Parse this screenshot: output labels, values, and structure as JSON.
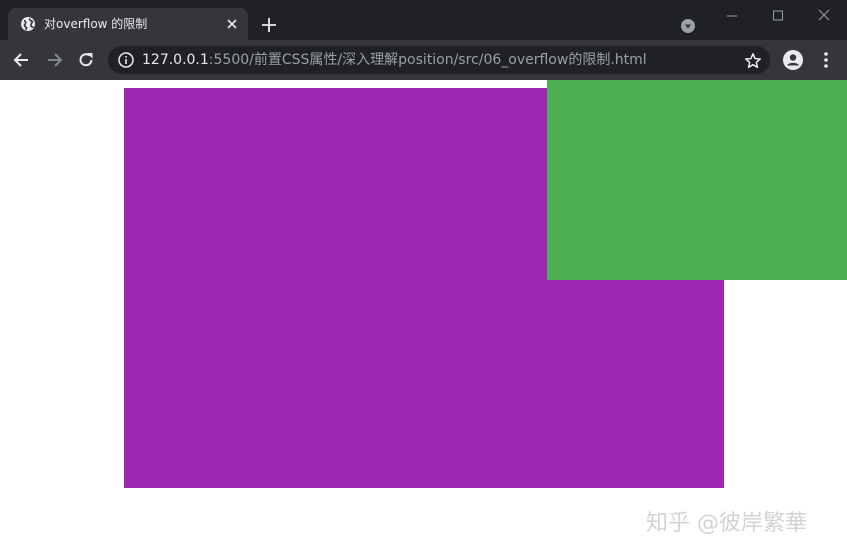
{
  "tab": {
    "title": "对overflow 的限制",
    "favicon": "globe-icon"
  },
  "window_controls": [
    "minimize-icon",
    "maximize-icon",
    "close-icon"
  ],
  "address_bar": {
    "host": "127.0.0.1",
    "rest": ":5500/前置CSS属性/深入理解position/src/06_overflow的限制.html",
    "security_icon": "info-icon"
  },
  "page": {
    "purple_color": "#9c27b0",
    "green_color": "#4caf50"
  },
  "watermark": "知乎 @彼岸繁華"
}
